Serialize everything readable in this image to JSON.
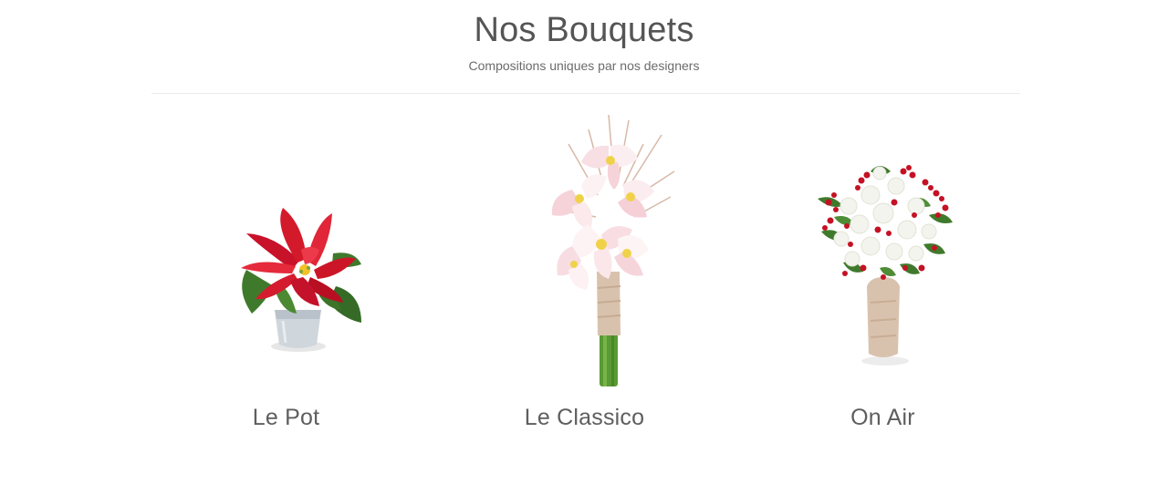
{
  "section": {
    "title": "Nos Bouquets",
    "subtitle": "Compositions uniques par nos designers"
  },
  "products": [
    {
      "name": "Le Pot",
      "image_icon": "poinsettia-pot-icon"
    },
    {
      "name": "Le Classico",
      "image_icon": "amaryllis-bouquet-icon"
    },
    {
      "name": "On Air",
      "image_icon": "roses-berries-bouquet-icon"
    }
  ],
  "colors": {
    "text": "#555555",
    "divider": "#ebebeb",
    "poinsettia_red": "#d31a2b",
    "leaf_green": "#3f7a2c",
    "berry_red": "#c41224",
    "amaryllis_pink": "#f6d3d8",
    "burlap": "#d9c2ad"
  }
}
